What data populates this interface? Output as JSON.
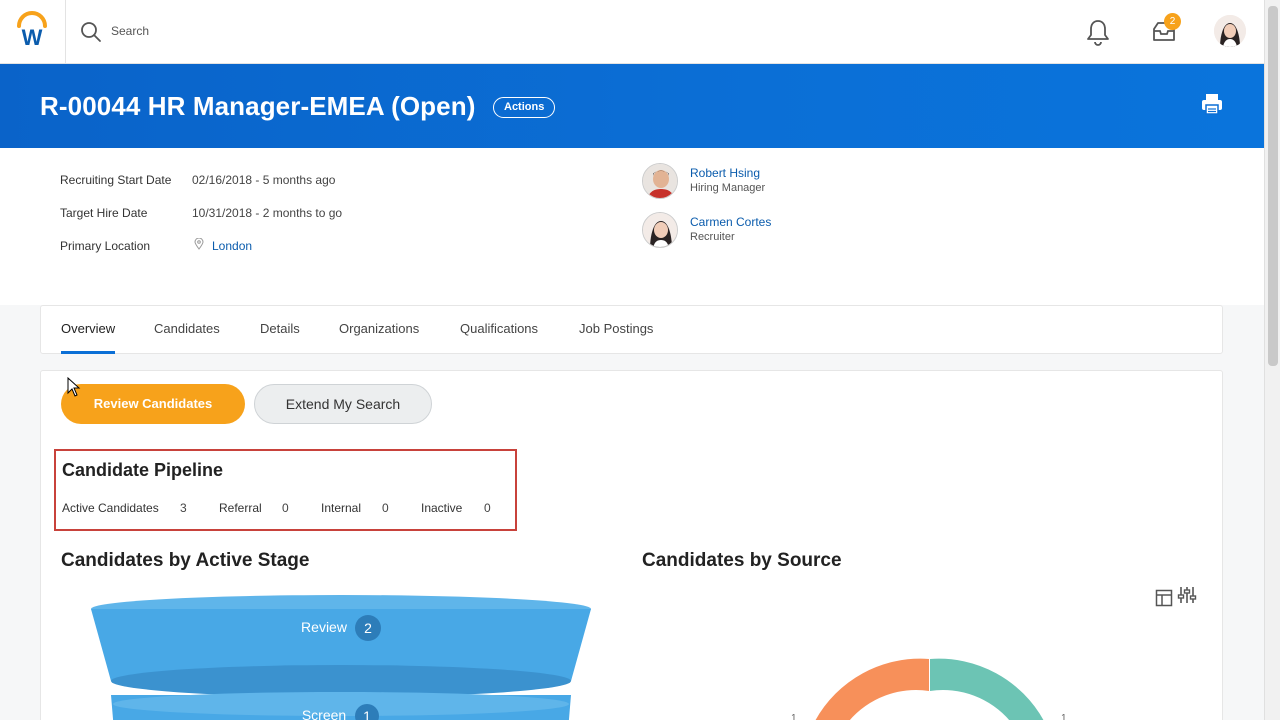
{
  "topbar": {
    "search_label": "Search",
    "inbox_badge": "2"
  },
  "header": {
    "title": "R-00044 HR Manager-EMEA (Open)",
    "actions_label": "Actions"
  },
  "info": {
    "fields": [
      {
        "label": "Recruiting Start Date",
        "value": "02/16/2018 - 5 months ago"
      },
      {
        "label": "Target Hire Date",
        "value": "10/31/2018 - 2 months to go"
      },
      {
        "label": "Primary Location",
        "value": "London"
      }
    ],
    "people": [
      {
        "name": "Robert Hsing",
        "role": "Hiring Manager"
      },
      {
        "name": "Carmen Cortes",
        "role": "Recruiter"
      }
    ]
  },
  "tabs": [
    "Overview",
    "Candidates",
    "Details",
    "Organizations",
    "Qualifications",
    "Job Postings"
  ],
  "buttons": {
    "review": "Review Candidates",
    "extend": "Extend My Search"
  },
  "pipeline": {
    "title": "Candidate Pipeline",
    "stats": [
      {
        "label": "Active Candidates",
        "value": "3"
      },
      {
        "label": "Referral",
        "value": "0"
      },
      {
        "label": "Internal",
        "value": "0"
      },
      {
        "label": "Inactive",
        "value": "0"
      }
    ]
  },
  "sections": {
    "stage_title": "Candidates by Active Stage",
    "source_title": "Candidates by Source"
  },
  "funnel": [
    {
      "label": "Review",
      "count": "2"
    },
    {
      "label": "Screen",
      "count": "1"
    }
  ],
  "donut_labels": [
    "1",
    "1"
  ],
  "colors": {
    "brand_blue": "#0b6fd6",
    "accent_orange": "#f7a21b",
    "funnel_blue": "#48a8e6",
    "donut_orange": "#f7905a",
    "donut_teal": "#6cc4b4",
    "highlight_red": "#c8423b"
  }
}
